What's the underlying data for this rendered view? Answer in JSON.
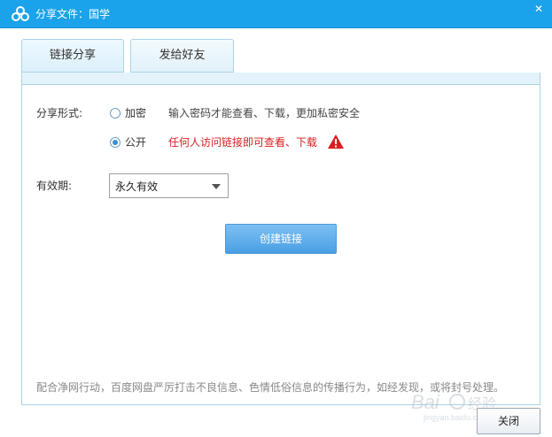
{
  "window": {
    "title": "分享文件：国学",
    "close_glyph": "✕"
  },
  "tabs": [
    {
      "label": "链接分享",
      "active": true
    },
    {
      "label": "发给好友",
      "active": false
    }
  ],
  "share_form": {
    "label": "分享形式:",
    "options": [
      {
        "label": "加密",
        "hint": "输入密码才能查看、下载，更加私密安全",
        "checked": false
      },
      {
        "label": "公开",
        "hint": "任何人访问链接即可查看、下载",
        "checked": true,
        "warning": true
      }
    ]
  },
  "validity": {
    "label": "有效期:",
    "selected": "永久有效"
  },
  "create_button": "创建链接",
  "notice": "配合净网行动，百度网盘严厉打击不良信息、色情低俗信息的传播行为，如经发现，或将封号处理。",
  "close_button": "关闭",
  "colors": {
    "titlebar": "#1aa3ea",
    "accent": "#4a9fe3",
    "warning": "#d82020"
  },
  "icons": {
    "app": "cloud-logo-icon",
    "warning": "warning-triangle-icon",
    "dropdown": "chevron-down-icon"
  }
}
